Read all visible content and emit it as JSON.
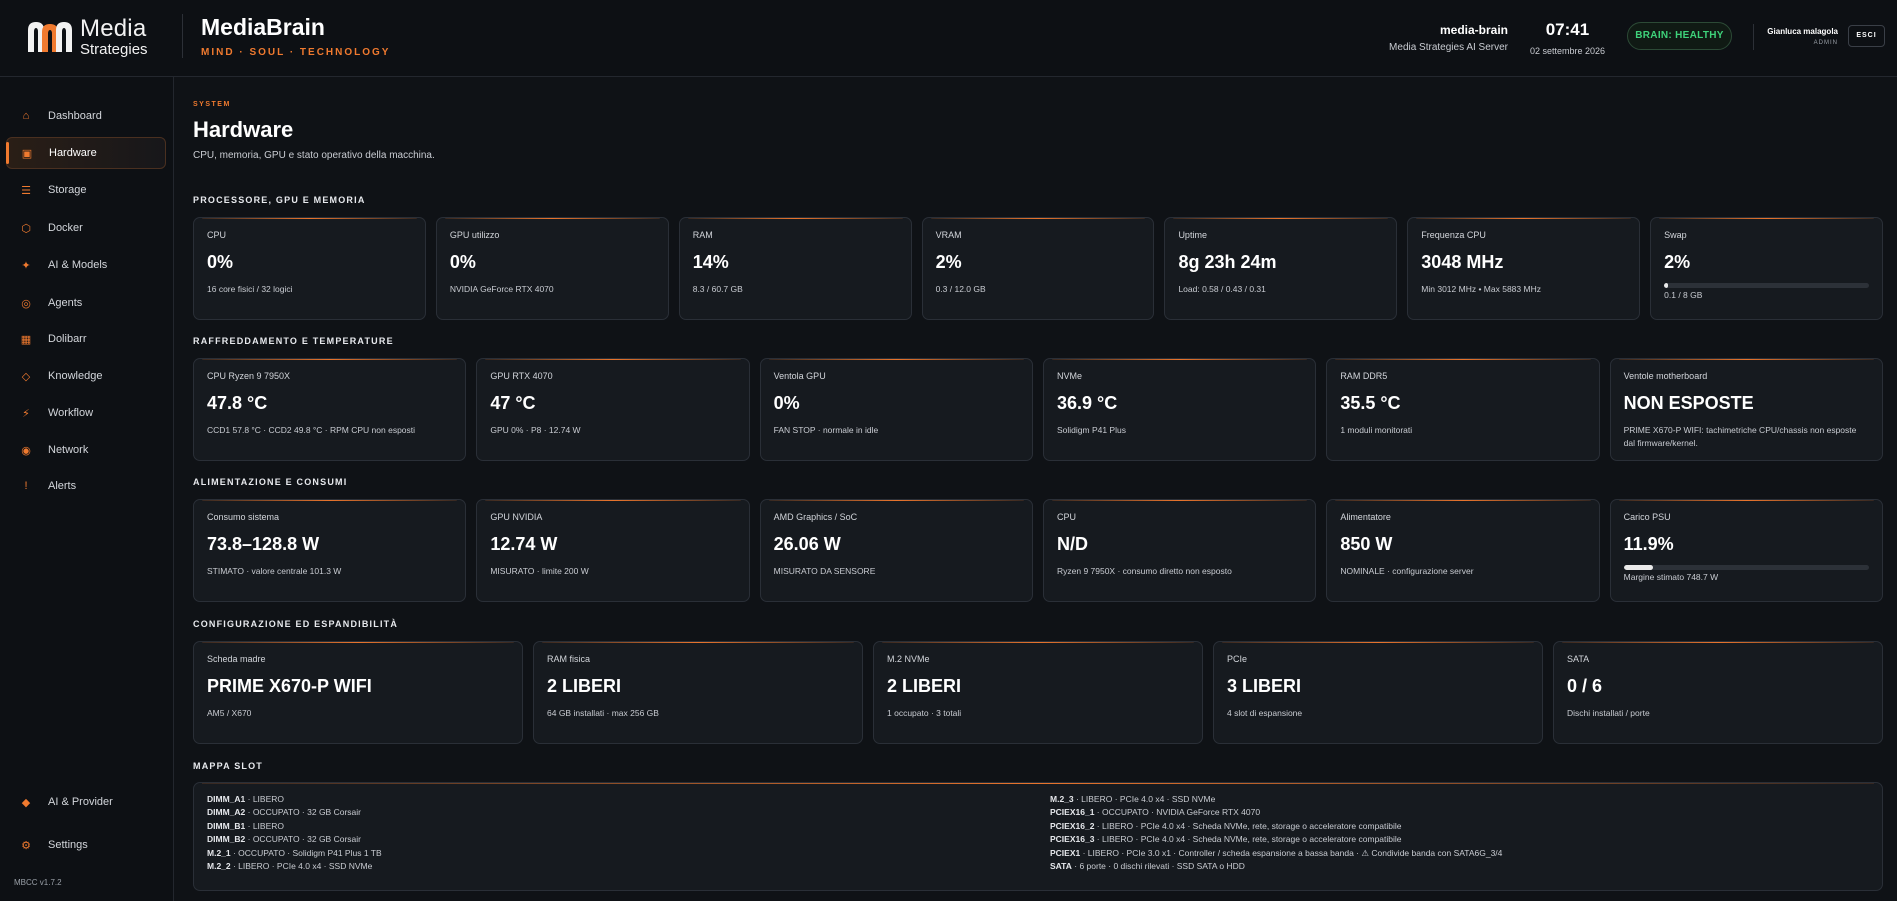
{
  "brand": {
    "logo_line1": "Media",
    "logo_line2": "Strategies",
    "app_title": "MediaBrain",
    "tagline": "MIND · SOUL · TECHNOLOGY"
  },
  "server": {
    "name": "media-brain",
    "description": "Media Strategies AI Server"
  },
  "clock": {
    "time": "07:41",
    "date": "02 settembre 2026"
  },
  "status": {
    "label": "BRAIN: HEALTHY",
    "color": "#3ed27a"
  },
  "user": {
    "name": "Gianluca malagola",
    "role": "ADMIN",
    "logout_label": "ESCI"
  },
  "colors": {
    "accent": "#f07a2f",
    "background": "#0f1216",
    "card": "#161a1f",
    "healthy": "#3ed27a"
  },
  "sidebar": {
    "items": [
      {
        "label": "Dashboard",
        "icon": "home-icon",
        "glyph": "⌂"
      },
      {
        "label": "Hardware",
        "icon": "chip-icon",
        "glyph": "▣",
        "active": true
      },
      {
        "label": "Storage",
        "icon": "storage-icon",
        "glyph": "☰"
      },
      {
        "label": "Docker",
        "icon": "docker-icon",
        "glyph": "⬡"
      },
      {
        "label": "AI & Models",
        "icon": "sparkle-icon",
        "glyph": "✦"
      },
      {
        "label": "Agents",
        "icon": "agent-icon",
        "glyph": "◎"
      },
      {
        "label": "Dolibarr",
        "icon": "grid-icon",
        "glyph": "▦"
      },
      {
        "label": "Knowledge",
        "icon": "diamond-icon",
        "glyph": "◇"
      },
      {
        "label": "Workflow",
        "icon": "workflow-icon",
        "glyph": "⚡"
      },
      {
        "label": "Network",
        "icon": "network-icon",
        "glyph": "◉"
      },
      {
        "label": "Alerts",
        "icon": "alert-icon",
        "glyph": "!"
      }
    ],
    "bottom_items": [
      {
        "label": "AI & Provider",
        "icon": "provider-icon",
        "glyph": "◆"
      },
      {
        "label": "Settings",
        "icon": "gear-icon",
        "glyph": "⚙"
      }
    ],
    "version": "MBCC v1.7.2"
  },
  "page": {
    "kicker": "SYSTEM",
    "title": "Hardware",
    "subtitle": "CPU, memoria, GPU e stato operativo della macchina."
  },
  "sections": {
    "processor": {
      "title": "PROCESSORE, GPU E MEMORIA",
      "cards": [
        {
          "label": "CPU",
          "value": "0%",
          "detail": "16 core fisici / 32 logici"
        },
        {
          "label": "GPU utilizzo",
          "value": "0%",
          "detail": "NVIDIA GeForce RTX 4070"
        },
        {
          "label": "RAM",
          "value": "14%",
          "detail": "8.3 / 60.7 GB"
        },
        {
          "label": "VRAM",
          "value": "2%",
          "detail": "0.3 / 12.0 GB"
        },
        {
          "label": "Uptime",
          "value": "8g 23h 24m",
          "detail": "Load: 0.58 / 0.43 / 0.31"
        },
        {
          "label": "Frequenza CPU",
          "value": "3048 MHz",
          "detail": "Min 3012 MHz • Max 5883 MHz"
        },
        {
          "label": "Swap",
          "value": "2%",
          "detail": "0.1 / 8 GB",
          "bar": 0.02
        }
      ]
    },
    "cooling": {
      "title": "RAFFREDDAMENTO E TEMPERATURE",
      "cards": [
        {
          "label": "CPU Ryzen 9 7950X",
          "value": "47.8 °C",
          "detail": "CCD1 57.8 °C · CCD2 49.8 °C · RPM CPU non esposti"
        },
        {
          "label": "GPU RTX 4070",
          "value": "47 °C",
          "detail": "GPU 0% · P8 · 12.74 W"
        },
        {
          "label": "Ventola GPU",
          "value": "0%",
          "detail": "FAN STOP · normale in idle"
        },
        {
          "label": "NVMe",
          "value": "36.9 °C",
          "detail": "Solidigm P41 Plus"
        },
        {
          "label": "RAM DDR5",
          "value": "35.5 °C",
          "detail": "1 moduli monitorati"
        },
        {
          "label": "Ventole motherboard",
          "value": "NON ESPOSTE",
          "detail": "PRIME X670-P WIFI: tachimetriche CPU/chassis non esposte dal firmware/kernel."
        }
      ]
    },
    "power": {
      "title": "ALIMENTAZIONE E CONSUMI",
      "cards": [
        {
          "label": "Consumo sistema",
          "value": "73.8–128.8 W",
          "detail": "STIMATO · valore centrale 101.3 W"
        },
        {
          "label": "GPU NVIDIA",
          "value": "12.74 W",
          "detail": "MISURATO · limite 200 W"
        },
        {
          "label": "AMD Graphics / SoC",
          "value": "26.06 W",
          "detail": "MISURATO DA SENSORE"
        },
        {
          "label": "CPU",
          "value": "N/D",
          "detail": "Ryzen 9 7950X · consumo diretto non esposto"
        },
        {
          "label": "Alimentatore",
          "value": "850 W",
          "detail": "NOMINALE · configurazione server"
        },
        {
          "label": "Carico PSU",
          "value": "11.9%",
          "detail": "Margine stimato 748.7 W",
          "bar": 0.119
        }
      ]
    },
    "config": {
      "title": "CONFIGURAZIONE ED ESPANDIBILITÀ",
      "cards": [
        {
          "label": "Scheda madre",
          "value": "PRIME X670-P WIFI",
          "detail": "AM5 / X670"
        },
        {
          "label": "RAM fisica",
          "value": "2 LIBERI",
          "detail": "64 GB installati · max 256 GB"
        },
        {
          "label": "M.2 NVMe",
          "value": "2 LIBERI",
          "detail": "1 occupato · 3 totali"
        },
        {
          "label": "PCIe",
          "value": "3 LIBERI",
          "detail": "4 slot di espansione"
        },
        {
          "label": "SATA",
          "value": "0 / 6",
          "detail": "Dischi installati / porte"
        }
      ]
    },
    "slotmap": {
      "title": "MAPPA SLOT",
      "left": [
        {
          "slot": "DIMM_A1",
          "info": " · LIBERO"
        },
        {
          "slot": "DIMM_A2",
          "info": " · OCCUPATO · 32 GB Corsair"
        },
        {
          "slot": "DIMM_B1",
          "info": " · LIBERO"
        },
        {
          "slot": "DIMM_B2",
          "info": " · OCCUPATO · 32 GB Corsair"
        },
        {
          "slot": "M.2_1",
          "info": " · OCCUPATO · Solidigm P41 Plus 1 TB"
        },
        {
          "slot": "M.2_2",
          "info": " · LIBERO · PCIe 4.0 x4 · SSD NVMe"
        }
      ],
      "right": [
        {
          "slot": "M.2_3",
          "info": " · LIBERO · PCIe 4.0 x4 · SSD NVMe"
        },
        {
          "slot": "PCIEX16_1",
          "info": " · OCCUPATO · NVIDIA GeForce RTX 4070"
        },
        {
          "slot": "PCIEX16_2",
          "info": " · LIBERO · PCIe 4.0 x4 · Scheda NVMe, rete, storage o acceleratore compatibile"
        },
        {
          "slot": "PCIEX16_3",
          "info": " · LIBERO · PCIe 4.0 x4 · Scheda NVMe, rete, storage o acceleratore compatibile"
        },
        {
          "slot": "PCIEX1",
          "info": " · LIBERO · PCIe 3.0 x1 · Controller / scheda espansione a bassa banda · ⚠ Condivide banda con SATA6G_3/4"
        },
        {
          "slot": "SATA",
          "info": " · 6 porte · 0 dischi rilevati · SSD SATA o HDD"
        }
      ]
    }
  }
}
